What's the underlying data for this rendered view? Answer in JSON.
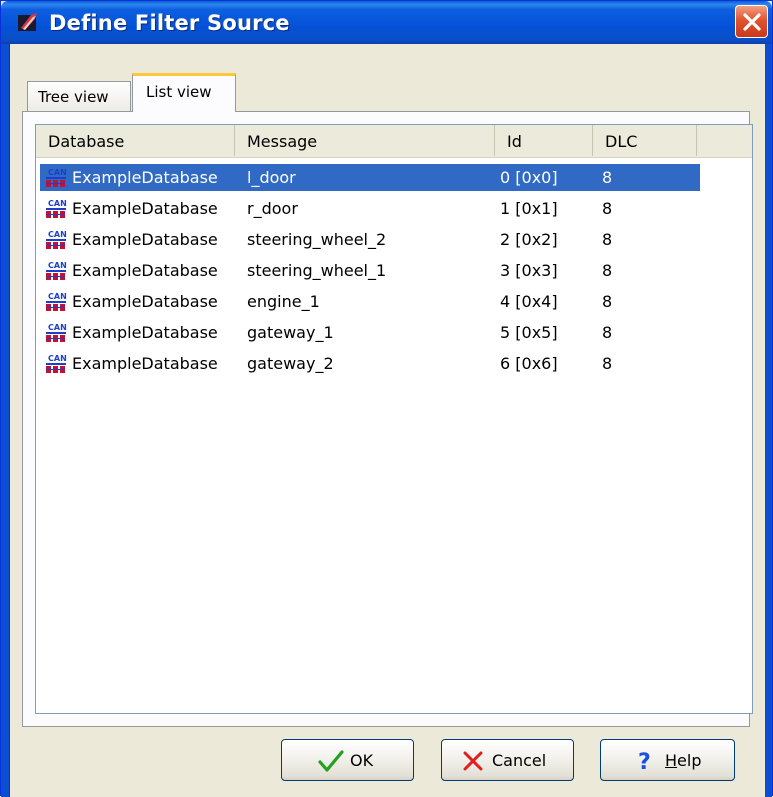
{
  "window": {
    "title": "Define Filter Source"
  },
  "tabs": [
    {
      "label": "Tree view",
      "active": false
    },
    {
      "label": "List view",
      "active": true
    }
  ],
  "list": {
    "columns": [
      "Database",
      "Message",
      "Id",
      "DLC"
    ],
    "rows": [
      {
        "icon": "can-database-icon",
        "database": "ExampleDatabase",
        "message": "l_door",
        "id": "0 [0x0]",
        "dlc": "8",
        "selected": true
      },
      {
        "icon": "can-database-icon",
        "database": "ExampleDatabase",
        "message": "r_door",
        "id": "1 [0x1]",
        "dlc": "8",
        "selected": false
      },
      {
        "icon": "can-database-icon",
        "database": "ExampleDatabase",
        "message": "steering_wheel_2",
        "id": "2 [0x2]",
        "dlc": "8",
        "selected": false
      },
      {
        "icon": "can-database-icon",
        "database": "ExampleDatabase",
        "message": "steering_wheel_1",
        "id": "3 [0x3]",
        "dlc": "8",
        "selected": false
      },
      {
        "icon": "can-database-icon",
        "database": "ExampleDatabase",
        "message": "engine_1",
        "id": "4 [0x4]",
        "dlc": "8",
        "selected": false
      },
      {
        "icon": "can-database-icon",
        "database": "ExampleDatabase",
        "message": "gateway_1",
        "id": "5 [0x5]",
        "dlc": "8",
        "selected": false
      },
      {
        "icon": "can-database-icon",
        "database": "ExampleDatabase",
        "message": "gateway_2",
        "id": "6 [0x6]",
        "dlc": "8",
        "selected": false
      }
    ]
  },
  "buttons": {
    "ok": {
      "label": "OK",
      "icon": "checkmark-icon"
    },
    "cancel": {
      "label": "Cancel",
      "icon": "x-icon"
    },
    "help": {
      "hotkey": "H",
      "rest": "elp",
      "icon": "question-icon"
    }
  },
  "colors": {
    "titlebar": "#0451d8",
    "selection": "#316ac5",
    "active_tab_accent": "#ffc83c",
    "close_button": "#e2542f"
  }
}
